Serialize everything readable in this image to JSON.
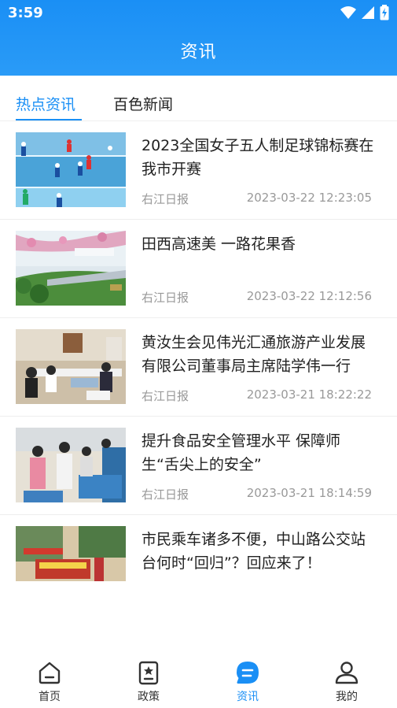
{
  "status_bar": {
    "time": "3:59"
  },
  "header": {
    "title": "资讯"
  },
  "tabs": [
    {
      "label": "热点资讯",
      "active": true
    },
    {
      "label": "百色新闻",
      "active": false
    }
  ],
  "news": [
    {
      "title": "2023全国女子五人制足球锦标赛在我市开赛",
      "source": "右江日报",
      "time": "2023-03-22 12:23:05"
    },
    {
      "title": "田西高速美 一路花果香",
      "source": "右江日报",
      "time": "2023-03-22 12:12:56"
    },
    {
      "title": "黄汝生会见伟光汇通旅游产业发展有限公司董事局主席陆学伟一行",
      "source": "右江日报",
      "time": "2023-03-21 18:22:22"
    },
    {
      "title": "提升食品安全管理水平 保障师生“舌尖上的安全”",
      "source": "右江日报",
      "time": "2023-03-21 18:14:59"
    },
    {
      "title": "市民乘车诸多不便，中山路公交站台何时“回归”？回应来了！",
      "source": "",
      "time": ""
    }
  ],
  "bottom_nav": [
    {
      "label": "首页",
      "icon": "home-icon",
      "active": false
    },
    {
      "label": "政策",
      "icon": "policy-icon",
      "active": false
    },
    {
      "label": "资讯",
      "icon": "news-icon",
      "active": true
    },
    {
      "label": "我的",
      "icon": "profile-icon",
      "active": false
    }
  ],
  "colors": {
    "accent": "#1a8ff5",
    "text": "#222222",
    "muted": "#999999"
  }
}
